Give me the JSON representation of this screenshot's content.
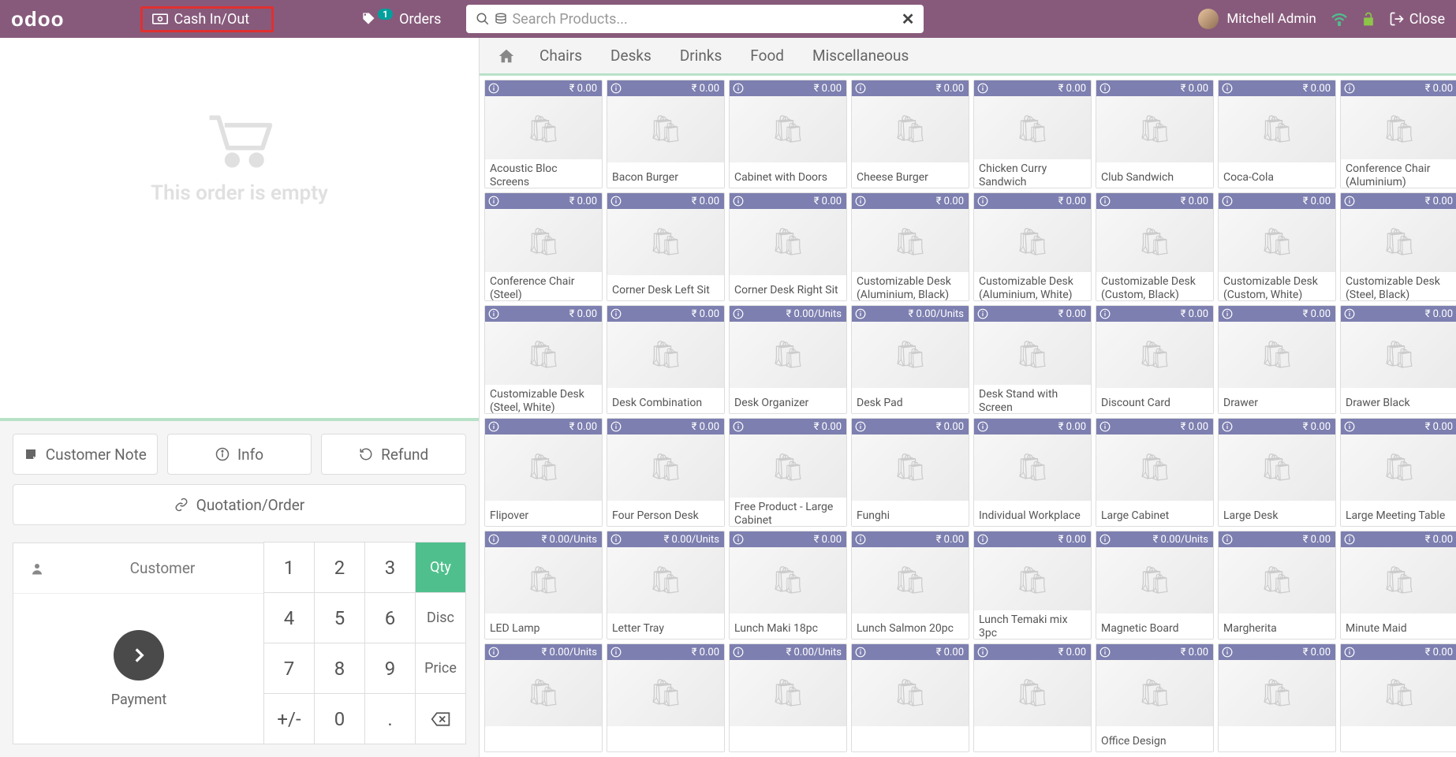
{
  "header": {
    "logo": "odoo",
    "cash_btn": "Cash In/Out",
    "orders_btn": "Orders",
    "orders_badge": "1",
    "search_placeholder": "Search Products...",
    "user": "Mitchell Admin",
    "close": "Close"
  },
  "cart": {
    "empty_text": "This order is empty"
  },
  "actions": {
    "customer_note": "Customer Note",
    "info": "Info",
    "refund": "Refund",
    "quotation": "Quotation/Order"
  },
  "pad": {
    "customer": "Customer",
    "payment": "Payment",
    "qty": "Qty",
    "disc": "Disc",
    "price": "Price",
    "keys": [
      "1",
      "2",
      "3",
      "4",
      "5",
      "6",
      "7",
      "8",
      "9",
      "+/-",
      "0",
      "."
    ]
  },
  "categories": [
    "Chairs",
    "Desks",
    "Drinks",
    "Food",
    "Miscellaneous"
  ],
  "products": [
    {
      "name": "Acoustic Bloc Screens",
      "price": "₹ 0.00"
    },
    {
      "name": "Bacon Burger",
      "price": "₹ 0.00"
    },
    {
      "name": "Cabinet with Doors",
      "price": "₹ 0.00"
    },
    {
      "name": "Cheese Burger",
      "price": "₹ 0.00"
    },
    {
      "name": "Chicken Curry Sandwich",
      "price": "₹ 0.00"
    },
    {
      "name": "Club Sandwich",
      "price": "₹ 0.00"
    },
    {
      "name": "Coca-Cola",
      "price": "₹ 0.00"
    },
    {
      "name": "Conference Chair (Aluminium)",
      "price": "₹ 0.00"
    },
    {
      "name": "Conference Chair (Steel)",
      "price": "₹ 0.00"
    },
    {
      "name": "Corner Desk Left Sit",
      "price": "₹ 0.00"
    },
    {
      "name": "Corner Desk Right Sit",
      "price": "₹ 0.00"
    },
    {
      "name": "Customizable Desk (Aluminium, Black)",
      "price": "₹ 0.00"
    },
    {
      "name": "Customizable Desk (Aluminium, White)",
      "price": "₹ 0.00"
    },
    {
      "name": "Customizable Desk (Custom, Black)",
      "price": "₹ 0.00"
    },
    {
      "name": "Customizable Desk (Custom, White)",
      "price": "₹ 0.00"
    },
    {
      "name": "Customizable Desk (Steel, Black)",
      "price": "₹ 0.00"
    },
    {
      "name": "Customizable Desk (Steel, White)",
      "price": "₹ 0.00"
    },
    {
      "name": "Desk Combination",
      "price": "₹ 0.00"
    },
    {
      "name": "Desk Organizer",
      "price": "₹ 0.00/Units"
    },
    {
      "name": "Desk Pad",
      "price": "₹ 0.00/Units"
    },
    {
      "name": "Desk Stand with Screen",
      "price": "₹ 0.00"
    },
    {
      "name": "Discount Card",
      "price": "₹ 0.00"
    },
    {
      "name": "Drawer",
      "price": "₹ 0.00"
    },
    {
      "name": "Drawer Black",
      "price": "₹ 0.00"
    },
    {
      "name": "Flipover",
      "price": "₹ 0.00"
    },
    {
      "name": "Four Person Desk",
      "price": "₹ 0.00"
    },
    {
      "name": "Free Product - Large Cabinet",
      "price": "₹ 0.00"
    },
    {
      "name": "Funghi",
      "price": "₹ 0.00"
    },
    {
      "name": "Individual Workplace",
      "price": "₹ 0.00"
    },
    {
      "name": "Large Cabinet",
      "price": "₹ 0.00"
    },
    {
      "name": "Large Desk",
      "price": "₹ 0.00"
    },
    {
      "name": "Large Meeting Table",
      "price": "₹ 0.00"
    },
    {
      "name": "LED Lamp",
      "price": "₹ 0.00/Units"
    },
    {
      "name": "Letter Tray",
      "price": "₹ 0.00/Units"
    },
    {
      "name": "Lunch Maki 18pc",
      "price": "₹ 0.00"
    },
    {
      "name": "Lunch Salmon 20pc",
      "price": "₹ 0.00"
    },
    {
      "name": "Lunch Temaki mix 3pc",
      "price": "₹ 0.00"
    },
    {
      "name": "Magnetic Board",
      "price": "₹ 0.00/Units"
    },
    {
      "name": "Margherita",
      "price": "₹ 0.00"
    },
    {
      "name": "Minute Maid",
      "price": "₹ 0.00"
    },
    {
      "name": "",
      "price": "₹ 0.00/Units"
    },
    {
      "name": "",
      "price": "₹ 0.00"
    },
    {
      "name": "",
      "price": "₹ 0.00/Units"
    },
    {
      "name": "",
      "price": "₹ 0.00"
    },
    {
      "name": "",
      "price": "₹ 0.00"
    },
    {
      "name": "Office Design",
      "price": "₹ 0.00"
    },
    {
      "name": "",
      "price": "₹ 0.00"
    },
    {
      "name": "",
      "price": "₹ 0.00"
    }
  ]
}
